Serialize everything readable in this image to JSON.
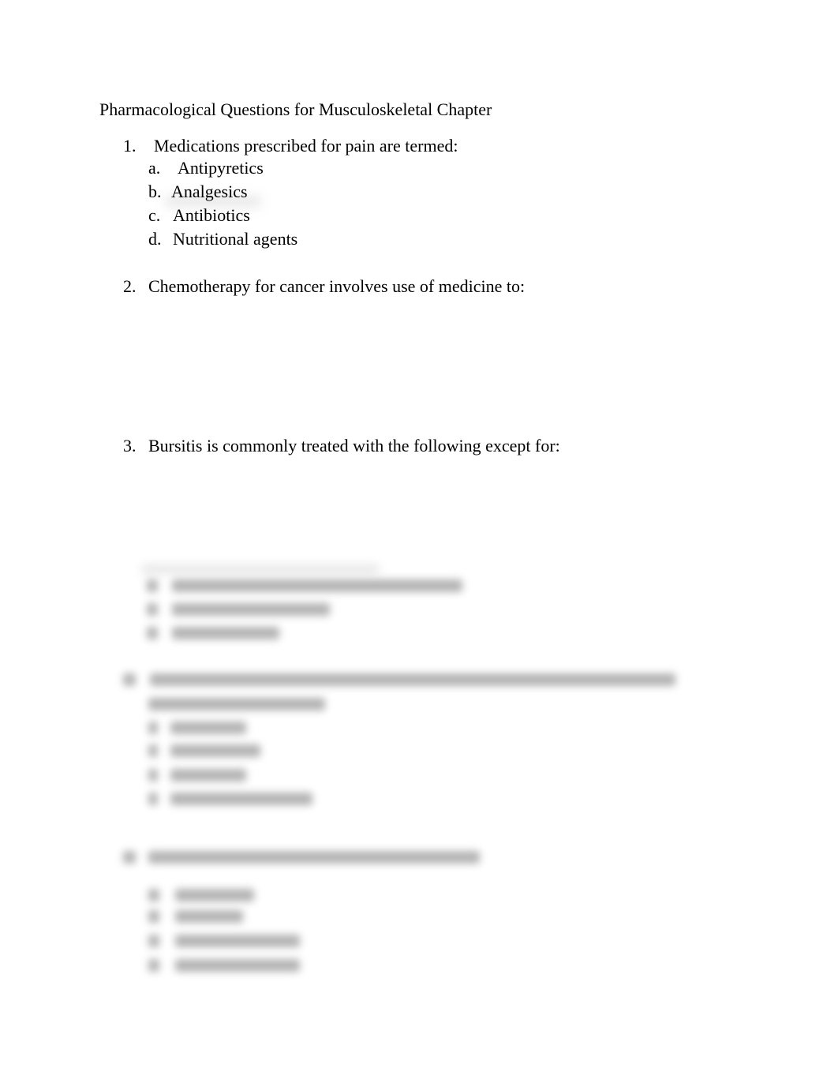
{
  "document": {
    "title": "Pharmacological Questions for Musculoskeletal Chapter",
    "questions": [
      {
        "number": "1.",
        "text": "Medications prescribed for pain are termed:",
        "options": [
          {
            "letter": "a.",
            "text": "Antipyretics"
          },
          {
            "letter": "b.",
            "text": "Analgesics"
          },
          {
            "letter": "c.",
            "text": "Antibiotics"
          },
          {
            "letter": "d.",
            "text": "Nutritional agents"
          }
        ]
      },
      {
        "number": "2.",
        "text": "Chemotherapy for cancer involves use of medicine to:"
      },
      {
        "number": "3.",
        "text": "Bursitis is commonly treated with the following except for:"
      }
    ],
    "blurred_content_note": "Remaining content is blurred and illegible"
  }
}
